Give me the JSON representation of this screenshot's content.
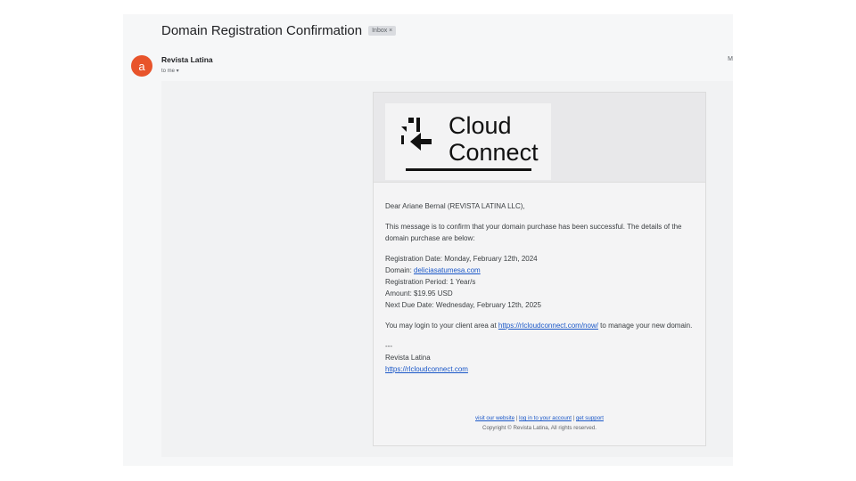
{
  "email": {
    "subject": "Domain Registration Confirmation",
    "label_badge": "Inbox ×",
    "sender_initial": "a",
    "sender_name": "Revista Latina",
    "recipient": "to me ▾",
    "right_cut_text": "M"
  },
  "logo": {
    "line1": "Cloud",
    "line2": "Connect"
  },
  "message": {
    "greeting": "Dear Ariane Bernal (REVISTA LATINA LLC),",
    "intro": "This message is to confirm that your domain purchase has been successful. The details of the domain purchase are below:",
    "registration_date": "Registration Date: Monday, February 12th, 2024",
    "domain_label": "Domain: ",
    "domain_link": "deliciasatumesa.com",
    "period": "Registration Period: 1 Year/s",
    "amount": "Amount: $19.95 USD",
    "due_date": "Next Due Date: Wednesday, February 12th, 2025",
    "login_prefix": "You may login to your client area at ",
    "login_link": "https://rlcloudconnect.com/now/",
    "login_suffix": " to manage your new domain.",
    "signature_dashes": "---",
    "signature_name": "Revista Latina",
    "signature_link": "https://rlcloudconnect.com"
  },
  "footer": {
    "visit": "visit our website",
    "sep": " | ",
    "login": "log in to your account",
    "support": "get support",
    "copyright": "Copyright © Revista Latina, All rights reserved."
  }
}
